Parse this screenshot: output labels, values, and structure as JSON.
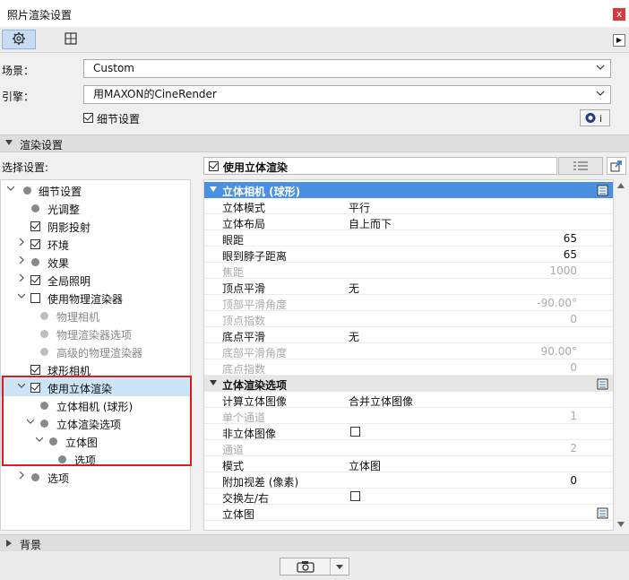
{
  "window": {
    "title": "照片渲染设置",
    "close_glyph": "x"
  },
  "toolbar": {
    "tabs": [
      {
        "icon": "gear-icon"
      },
      {
        "icon": "grid-icon"
      }
    ],
    "arrow_glyph": "▶"
  },
  "scene": {
    "label": "场景：",
    "value": "Custom"
  },
  "engine": {
    "label": "引擎：",
    "value": "用MAXON的CineRender"
  },
  "detail_settings": {
    "label": "细节设置",
    "checked": true
  },
  "render_settings_header": "渲染设置",
  "select_settings_label": "选择设置:",
  "tree": [
    {
      "label": "细节设置"
    },
    {
      "label": "光调整"
    },
    {
      "label": "阴影投射"
    },
    {
      "label": "环境"
    },
    {
      "label": "效果"
    },
    {
      "label": "全局照明"
    },
    {
      "label": "使用物理渲染器"
    },
    {
      "label": "物理相机"
    },
    {
      "label": "物理渲染器选项"
    },
    {
      "label": "高级的物理渲染器"
    },
    {
      "label": "球形相机"
    },
    {
      "label": "使用立体渲染"
    },
    {
      "label": "立体相机 (球形)"
    },
    {
      "label": "立体渲染选项"
    },
    {
      "label": "立体图"
    },
    {
      "label": "选项"
    },
    {
      "label": "选项"
    }
  ],
  "right_panel": {
    "header_label": "使用立体渲染",
    "group1": {
      "title": "立体相机 (球形)",
      "rows": [
        {
          "key": "立体模式",
          "value": "平行"
        },
        {
          "key": "立体布局",
          "value": "自上而下"
        },
        {
          "key": "眼距",
          "value": "65"
        },
        {
          "key": "眼到脖子距离",
          "value": "65"
        },
        {
          "key": "焦距",
          "value": "1000"
        },
        {
          "key": "顶点平滑",
          "value": "无"
        },
        {
          "key": "顶部平滑角度",
          "value": "-90.00°"
        },
        {
          "key": "顶点指数",
          "value": "0"
        },
        {
          "key": "底点平滑",
          "value": "无"
        },
        {
          "key": "底部平滑角度",
          "value": "90.00°"
        },
        {
          "key": "底点指数",
          "value": "0"
        }
      ]
    },
    "group2": {
      "title": "立体渲染选项",
      "rows": [
        {
          "key": "计算立体图像",
          "value": "合并立体图像"
        },
        {
          "key": "单个通道",
          "value": "1"
        },
        {
          "key": "非立体图像",
          "value": ""
        },
        {
          "key": "通道",
          "value": "2"
        },
        {
          "key": "模式",
          "value": "立体图"
        },
        {
          "key": "附加视差 (像素)",
          "value": "0"
        },
        {
          "key": "交换左/右",
          "value": ""
        },
        {
          "key": "立体图",
          "value": ""
        }
      ]
    }
  },
  "background_header": "背景"
}
